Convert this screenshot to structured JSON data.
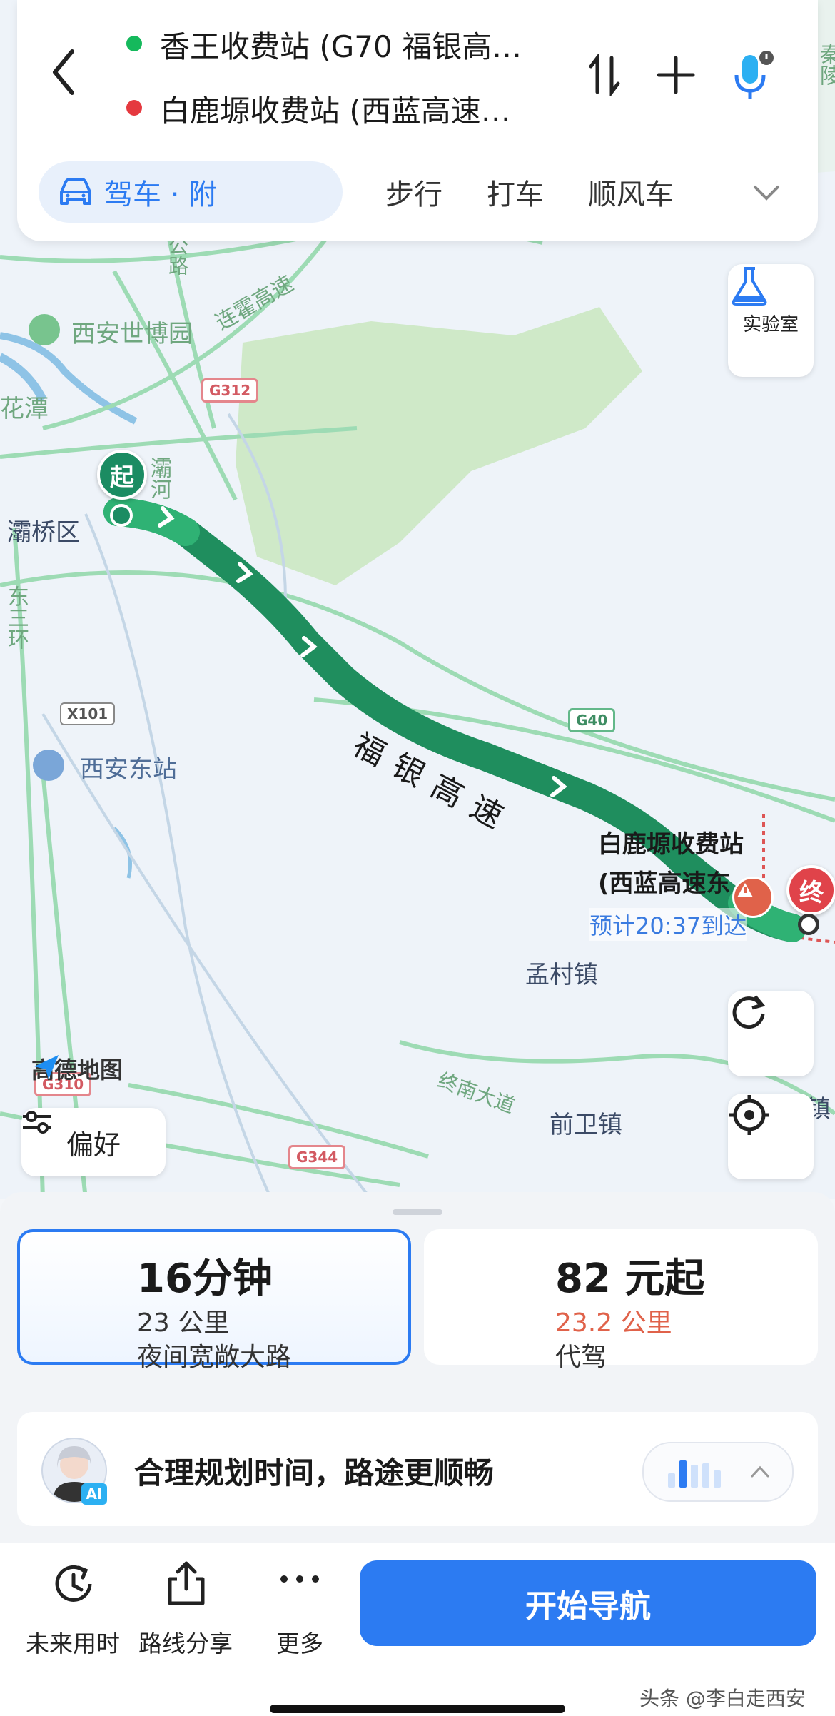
{
  "route": {
    "origin": "香王收费站 (G70 福银高…",
    "destination": "白鹿塬收费站 (西蓝高速…"
  },
  "tabs": {
    "drive": "驾车 · 附",
    "walk": "步行",
    "taxi": "打车",
    "carpool": "顺风车"
  },
  "lab_label": "实验室",
  "map": {
    "labels": {
      "expo": "西安世博园",
      "lianhuo": "连霍高速",
      "huatan": "花潭",
      "baqiao": "灞桥区",
      "bahe": "灞河",
      "highway": "福银高速",
      "dest_name": "白鹿塬收费站",
      "dest_sub": "(西蓝高速东",
      "eta": "预计20:37到达",
      "mengcun": "孟村镇",
      "qianwei": "前卫镇",
      "zhongnan": "终南大道",
      "xian_east": "西安东站",
      "east_ring": "东三环",
      "gonglu": "公路",
      "zhen": "镇",
      "qin": "秦陵",
      "logo": "高德地图"
    },
    "shields": {
      "g312": "G312",
      "g40": "G40",
      "x101": "X101",
      "g344": "G344",
      "g310": "G310"
    },
    "start_marker": "起",
    "end_marker": "终"
  },
  "preference_label": "偏好",
  "options": [
    {
      "title": "16分钟",
      "line1": "23 公里",
      "line2": "夜间宽敞大路"
    },
    {
      "title": "82 元起",
      "line1": "23.2 公里",
      "line2": "代驾"
    }
  ],
  "ai_banner": {
    "text": "合理规划时间，路途更顺畅",
    "badge": "AI"
  },
  "bottom": {
    "future": "未来用时",
    "share": "路线分享",
    "more": "更多",
    "start": "开始导航"
  },
  "watermark": "头条 @李白走西安",
  "colors": {
    "accent": "#2c7bf2",
    "route": "#1f8e5e",
    "warn": "#e0624a"
  }
}
